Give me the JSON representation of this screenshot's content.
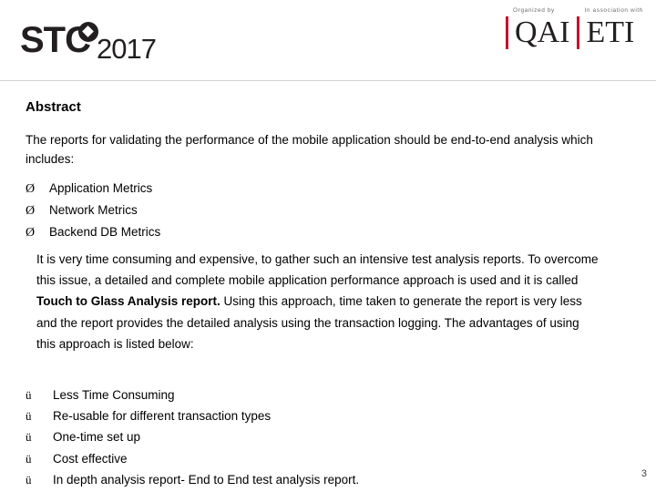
{
  "header": {
    "logo": {
      "brand": "STC",
      "year": "2017",
      "icon": "diamond-in-circle"
    },
    "sponsors": [
      {
        "caption": "Organized by",
        "name": "QAI"
      },
      {
        "caption": "In association with",
        "name": "ETI"
      }
    ]
  },
  "slide": {
    "title": "Abstract",
    "intro": "The reports for validating the performance of the mobile application should be end-to-end analysis which includes:",
    "metrics_marker": "Ø",
    "metrics": [
      "Application Metrics",
      "Network Metrics",
      "Backend DB Metrics"
    ],
    "paragraph_part1": "It is very time consuming and expensive, to gather such an intensive test analysis reports. To overcome this issue, a detailed and complete mobile application performance approach is used and it is called ",
    "paragraph_bold": "Touch to Glass Analysis report.",
    "paragraph_part2": " Using this approach, time taken to generate the report is very less and the report provides the detailed analysis using the transaction logging. The advantages of using this approach is listed below:",
    "advantages_marker": "ü",
    "advantages": [
      "Less Time Consuming",
      "Re-usable for different transaction types",
      "One-time set up",
      "Cost effective",
      "In depth analysis report- End to End test analysis report."
    ],
    "page_number": "3"
  }
}
